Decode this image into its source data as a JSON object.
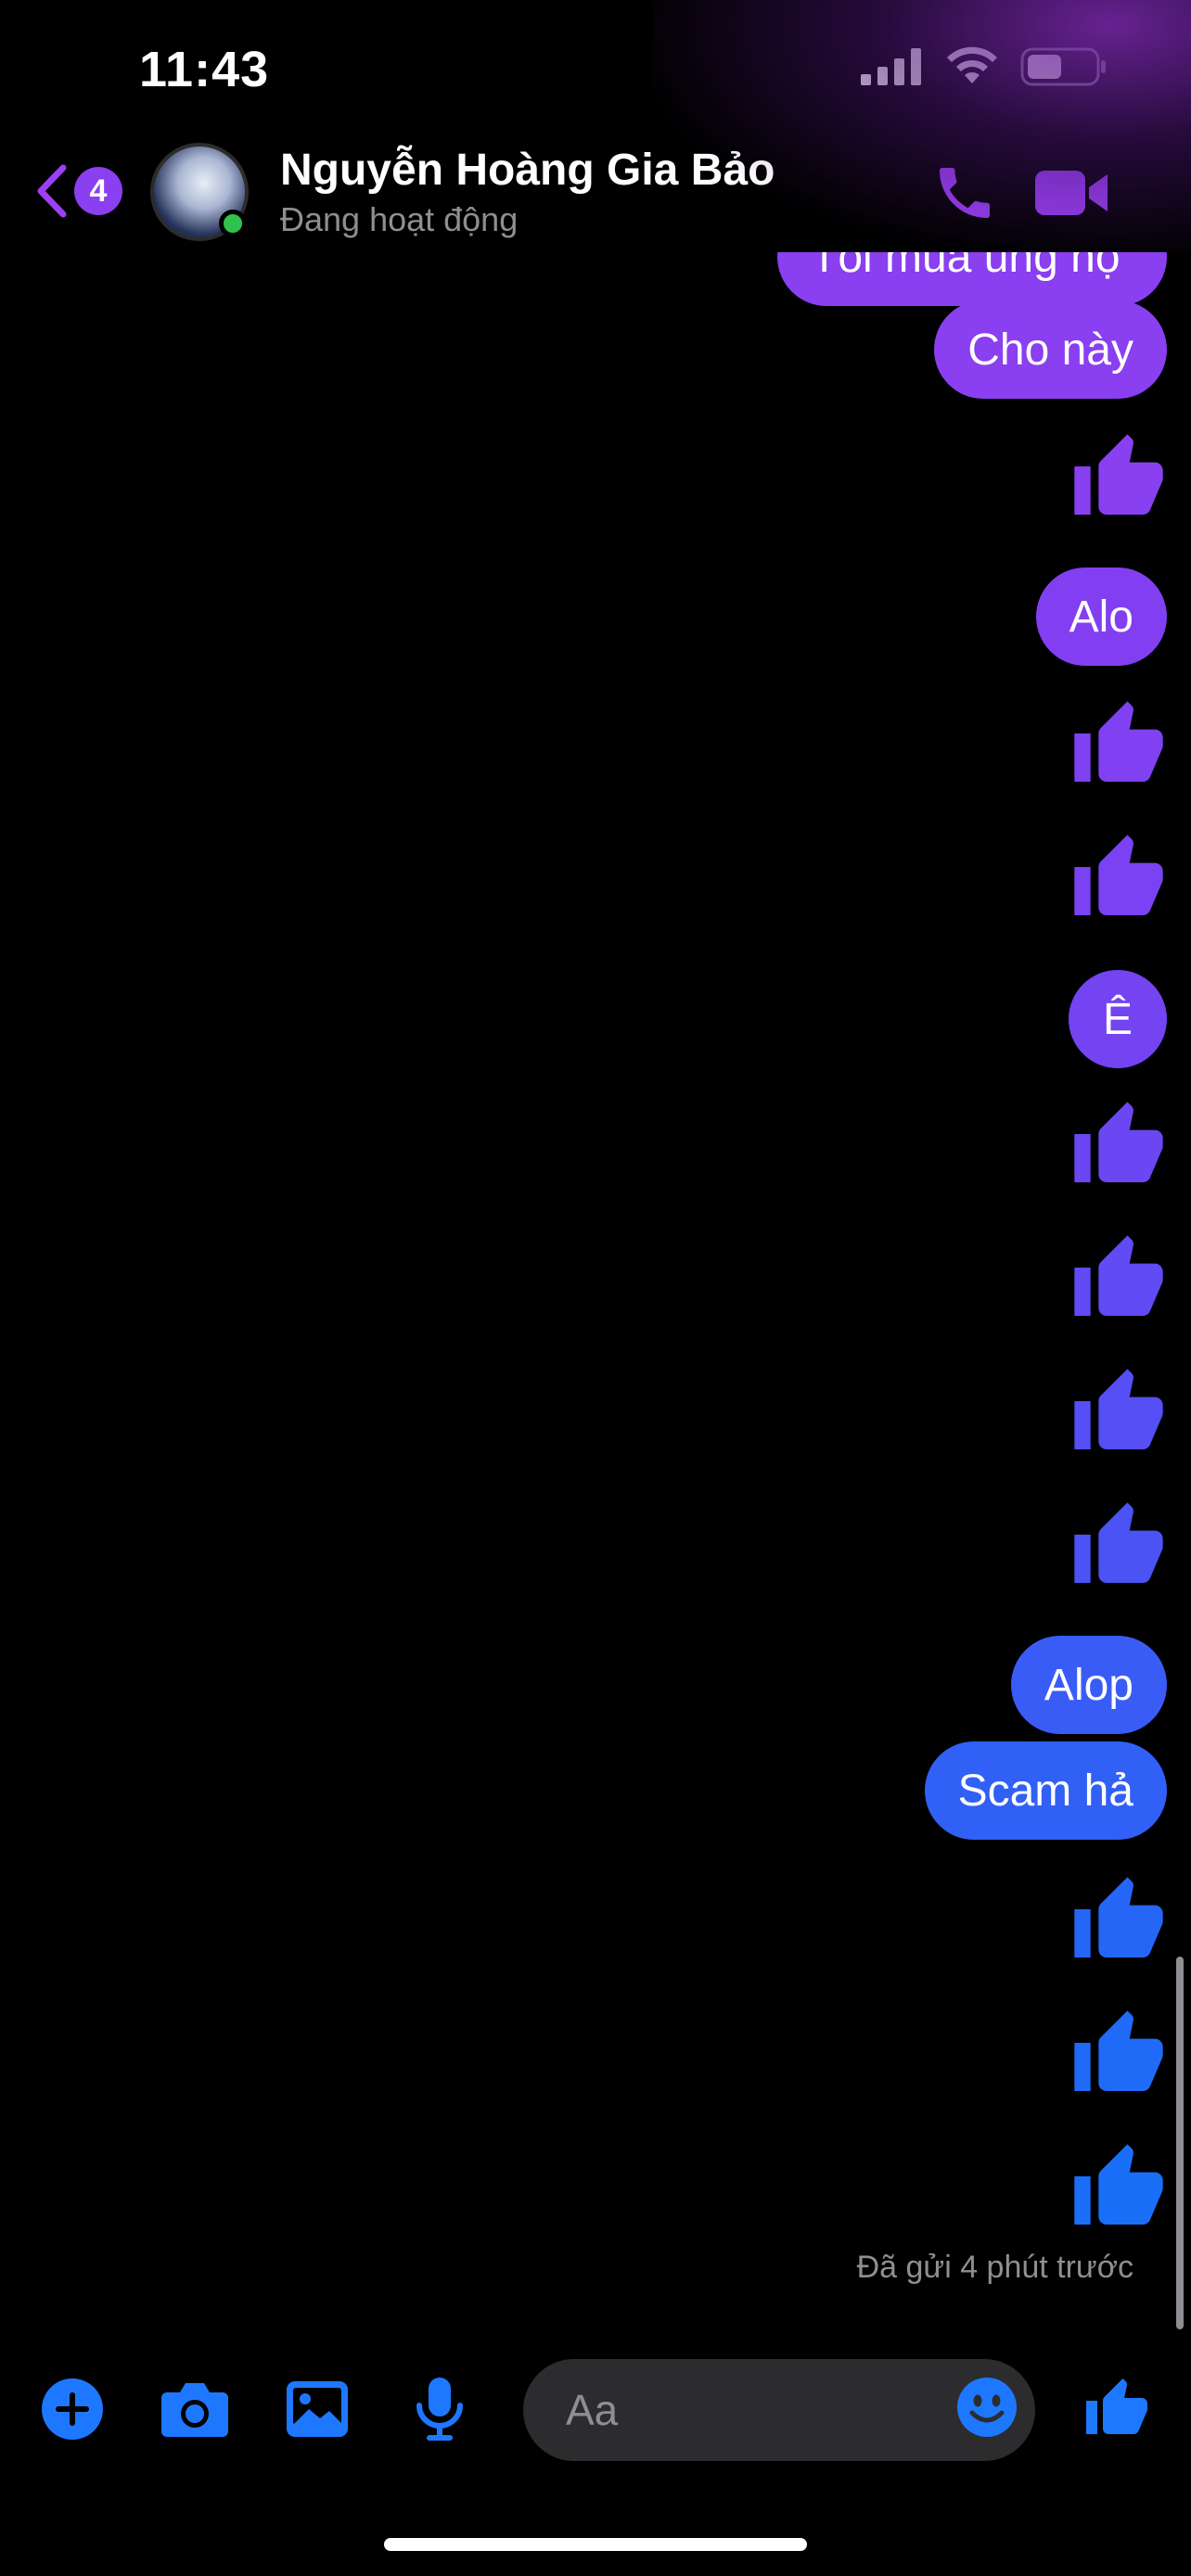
{
  "status_bar": {
    "time": "11:43",
    "signal_icon": "signal-bars-icon",
    "wifi_icon": "wifi-icon",
    "battery_icon": "battery-icon"
  },
  "header": {
    "back_icon": "chevron-left-icon",
    "unread_count": "4",
    "contact_name": "Nguyễn Hoàng Gia Bảo",
    "contact_status": "Đang hoạt động",
    "call_icon": "phone-icon",
    "video_icon": "video-camera-icon"
  },
  "messages": [
    {
      "kind": "text",
      "text": "Tôi mua ủng hộ"
    },
    {
      "kind": "text",
      "text": "Cho này"
    },
    {
      "kind": "like"
    },
    {
      "kind": "text",
      "text": "Alo"
    },
    {
      "kind": "like"
    },
    {
      "kind": "like"
    },
    {
      "kind": "text",
      "text": "Ê"
    },
    {
      "kind": "like"
    },
    {
      "kind": "like"
    },
    {
      "kind": "like"
    },
    {
      "kind": "like"
    },
    {
      "kind": "text",
      "text": "Alop"
    },
    {
      "kind": "text",
      "text": "Scam hả"
    },
    {
      "kind": "like"
    },
    {
      "kind": "like"
    },
    {
      "kind": "like"
    }
  ],
  "sent_status": "Đã gửi 4 phút trước",
  "composer": {
    "plus_icon": "plus-circle-icon",
    "camera_icon": "camera-icon",
    "gallery_icon": "photo-gallery-icon",
    "mic_icon": "microphone-icon",
    "input_placeholder": "Aa",
    "emoji_icon": "smiley-icon",
    "like_icon": "thumbs-up-icon"
  },
  "colors": {
    "background": "#000000",
    "bubble_gradient_top": "#8a3ff0",
    "bubble_gradient_bottom": "#1e6df7",
    "accent_purple": "#9b40f5",
    "accent_blue": "#1e78ff",
    "online": "#31c24d"
  }
}
